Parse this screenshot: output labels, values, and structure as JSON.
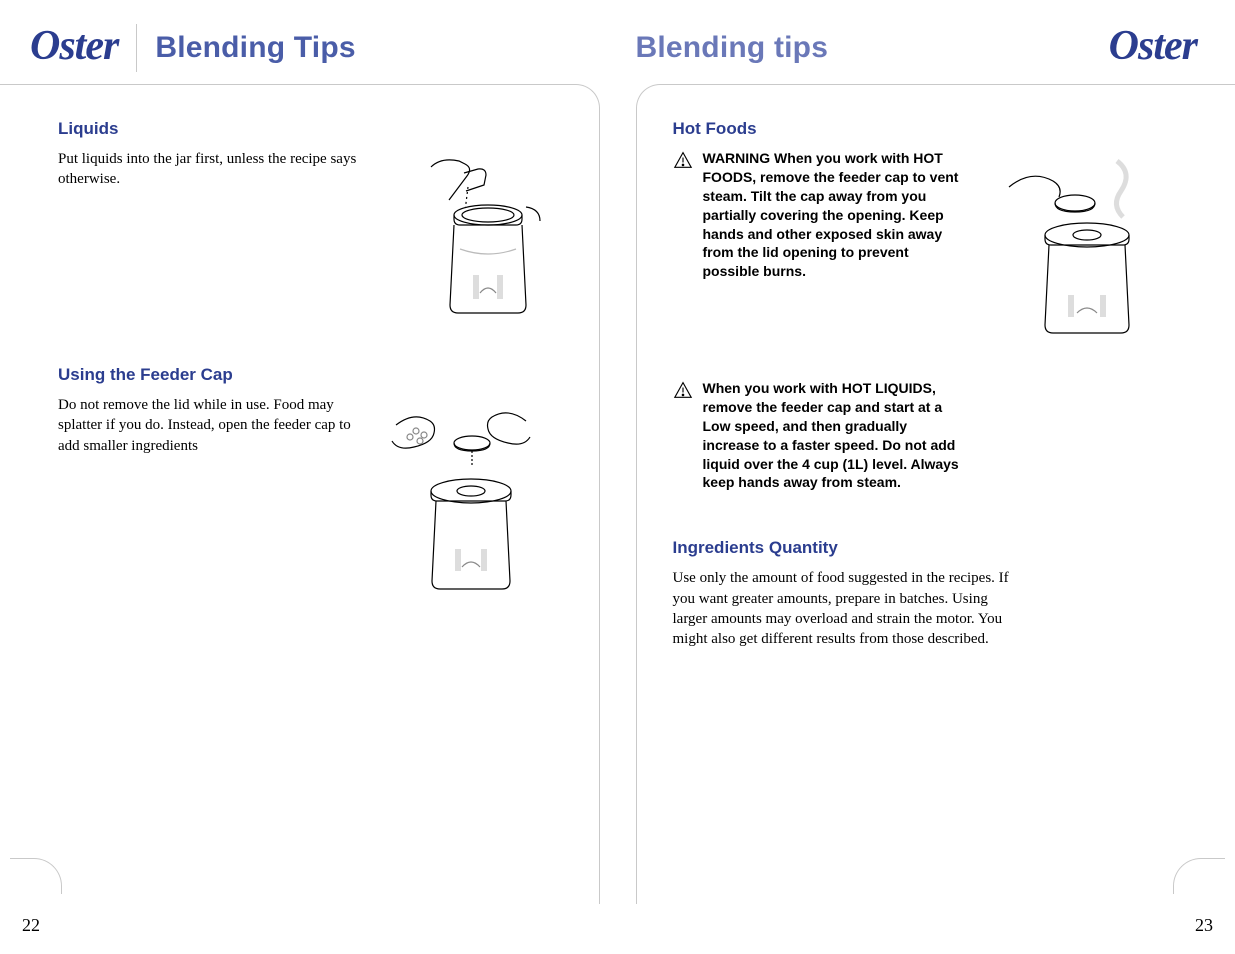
{
  "brand": "Oster",
  "left": {
    "title": "Blending Tips",
    "page_number": "22",
    "sections": [
      {
        "heading": "Liquids",
        "body": "Put liquids into the jar first, unless the recipe says otherwise.",
        "illustration": "hand-pouring-liquid-into-blender-jar"
      },
      {
        "heading": "Using the Feeder Cap",
        "body": "Do not remove the lid while in use. Food may splatter if you do. Instead, open the feeder cap to add smaller ingredients",
        "illustration": "hands-adding-ingredients-through-feeder-cap"
      }
    ]
  },
  "right": {
    "title": "Blending tips",
    "page_number": "23",
    "sections": [
      {
        "heading": "Hot Foods",
        "warnings": [
          "WARNING  When you work with HOT FOODS, remove the feeder cap to vent steam. Tilt the cap away from you partially covering the opening. Keep hands and other exposed skin away from the lid opening to prevent possible burns.",
          "When you work with HOT LIQUIDS, remove the feeder cap and start at a Low speed, and then gradually increase to a faster speed. Do not add liquid over the 4 cup (1L) level. Always keep hands away from steam."
        ],
        "illustration": "hand-tilting-feeder-cap-steam-from-blender"
      },
      {
        "heading": "Ingredients Quantity",
        "body": "Use only the amount of food suggested in the recipes. If you want greater amounts, prepare in batches. Using larger amounts may overload and strain the motor. You might also get different results from those described."
      }
    ]
  }
}
